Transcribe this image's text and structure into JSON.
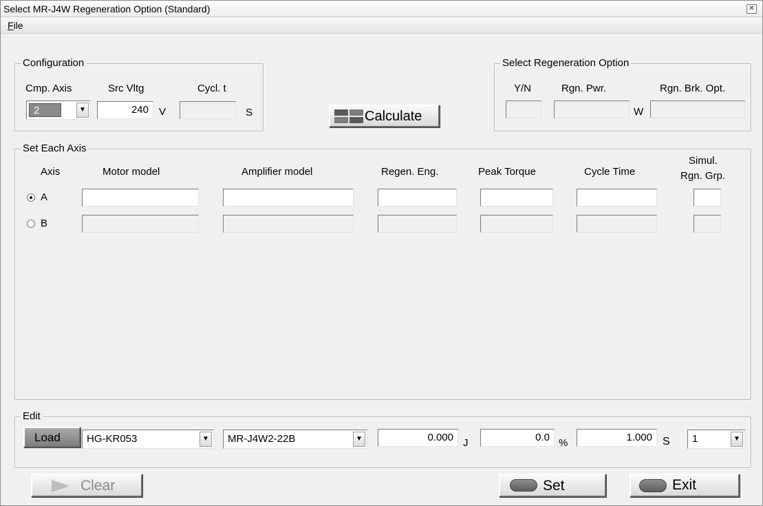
{
  "window": {
    "title": "Select MR-J4W Regeneration Option (Standard)",
    "close_glyph": "✕"
  },
  "menu": {
    "file_accel": "F",
    "file_rest": "ile"
  },
  "configuration": {
    "legend": "Configuration",
    "cmp_axis_label": "Cmp. Axis",
    "src_vltg_label": "Src Vltg",
    "cycl_t_label": "Cycl. t",
    "cmp_axis_value": "2",
    "src_vltg_value": "240",
    "src_vltg_unit": "V",
    "cycl_t_value": "",
    "cycl_t_unit": "S"
  },
  "calculate": {
    "label": "Calculate",
    "icon": "calculator-grid-icon"
  },
  "regen_option": {
    "legend": "Select Regeneration Option",
    "yn_label": "Y/N",
    "rgn_pwr_label": "Rgn. Pwr.",
    "rgn_brk_label": "Rgn. Brk. Opt.",
    "yn_value": "",
    "rgn_pwr_value": "",
    "rgn_pwr_unit": "W",
    "rgn_brk_value": ""
  },
  "axes": {
    "legend": "Set Each Axis",
    "headers": {
      "axis": "Axis",
      "motor": "Motor model",
      "amplifier": "Amplifier model",
      "regen_eng": "Regen. Eng.",
      "peak_torque": "Peak Torque",
      "cycle_time": "Cycle Time",
      "simul_1": "Simul.",
      "simul_2": "Rgn. Grp."
    },
    "rows": [
      {
        "axis": "A",
        "selected": true,
        "motor": "",
        "amplifier": "",
        "regen_eng": "",
        "peak_torque": "",
        "cycle_time": "",
        "simul": ""
      },
      {
        "axis": "B",
        "selected": false,
        "motor": "",
        "amplifier": "",
        "regen_eng": "",
        "peak_torque": "",
        "cycle_time": "",
        "simul": ""
      }
    ]
  },
  "edit": {
    "legend": "Edit",
    "load_label": "Load",
    "motor_value": "HG-KR053",
    "amplifier_value": "MR-J4W2-22B",
    "regen_eng_value": "0.000",
    "regen_eng_unit": "J",
    "peak_torque_value": "0.0",
    "peak_torque_unit": "%",
    "cycle_time_value": "1.000",
    "cycle_time_unit": "S",
    "simul_value": "1"
  },
  "buttons": {
    "clear_label": "Clear",
    "set_label": "Set",
    "exit_label": "Exit"
  },
  "icons": {
    "combo_arrow": "▼"
  },
  "colors": {
    "window_bg": "#f0f0f0",
    "selected_combo_bg": "#8a8a8a"
  }
}
